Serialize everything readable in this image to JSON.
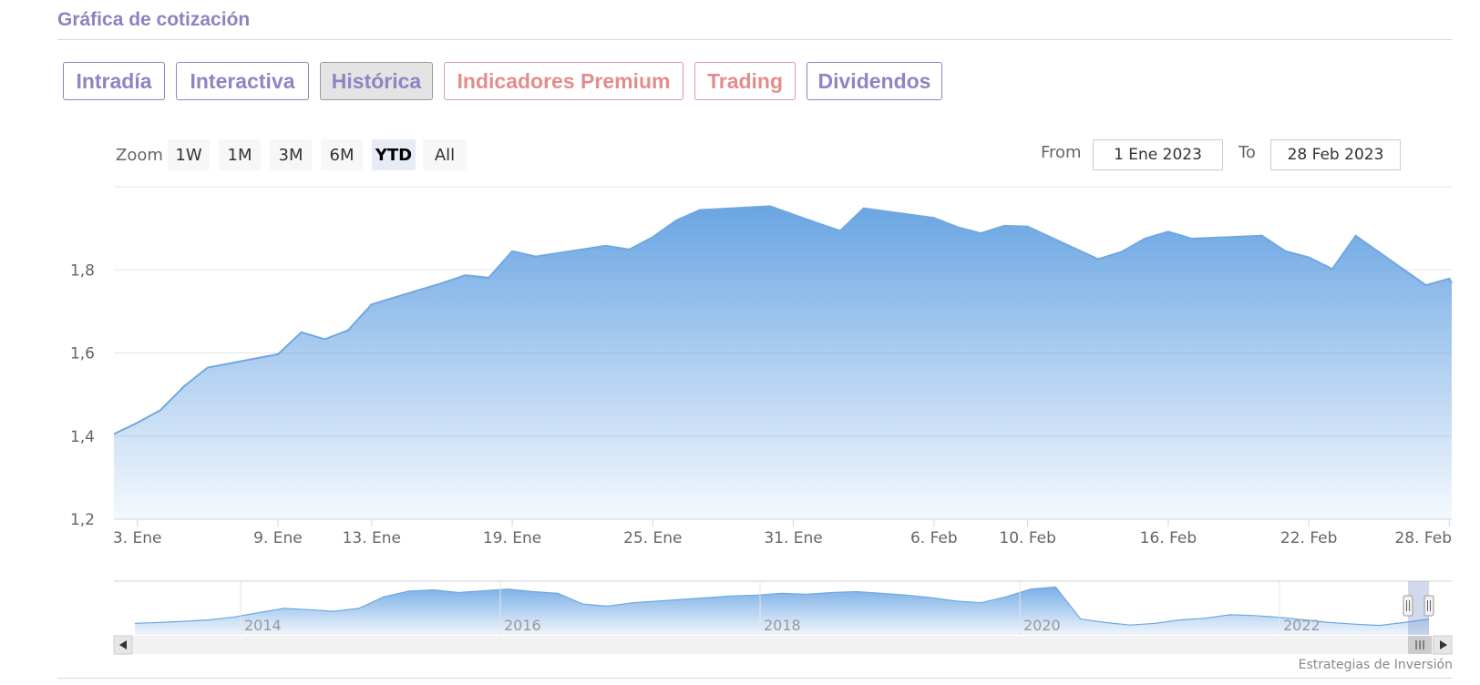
{
  "section_title": "Gráfica de cotización",
  "tabs": [
    {
      "label": "Intradía",
      "style": "normal"
    },
    {
      "label": "Interactiva",
      "style": "normal"
    },
    {
      "label": "Histórica",
      "style": "active"
    },
    {
      "label": "Indicadores Premium",
      "style": "premium"
    },
    {
      "label": "Trading",
      "style": "premium"
    },
    {
      "label": "Dividendos",
      "style": "normal"
    }
  ],
  "range_selector": {
    "zoom_label": "Zoom",
    "buttons": [
      "1W",
      "1M",
      "3M",
      "6M",
      "YTD",
      "All"
    ],
    "selected": "YTD",
    "from_label": "From",
    "from_value": "1 Ene 2023",
    "to_label": "To",
    "to_value": "28 Feb 2023"
  },
  "colors": {
    "accent": "#8a84c2",
    "premium": "#e48c8c",
    "series_line": "#6fa8e0",
    "series_fill_top": "#6aa5e3",
    "series_fill_bottom": "#f2f7fd"
  },
  "chart_data": {
    "type": "area",
    "y_tick_labels": [
      "1,2",
      "1,4",
      "1,6",
      "1,8"
    ],
    "y_ticks": [
      1.2,
      1.4,
      1.6,
      1.8
    ],
    "ylim": [
      1.2,
      2.0
    ],
    "x_tick_labels": [
      "3. Ene",
      "9. Ene",
      "13. Ene",
      "19. Ene",
      "25. Ene",
      "31. Ene",
      "6. Feb",
      "10. Feb",
      "16. Feb",
      "22. Feb",
      "28. Feb"
    ],
    "x_tick_days": [
      2,
      8,
      12,
      18,
      24,
      30,
      36,
      40,
      46,
      52,
      58
    ],
    "x_tick_values": [
      "2023-01-03",
      "2023-01-09",
      "2023-01-13",
      "2023-01-19",
      "2023-01-25",
      "2023-01-31",
      "2023-02-06",
      "2023-02-10",
      "2023-02-16",
      "2023-02-22",
      "2023-02-28"
    ],
    "xlim_days": [
      1,
      58.1
    ],
    "x_dates": [
      "2023-01-02",
      "2023-01-03",
      "2023-01-04",
      "2023-01-05",
      "2023-01-06",
      "2023-01-09",
      "2023-01-10",
      "2023-01-11",
      "2023-01-12",
      "2023-01-13",
      "2023-01-16",
      "2023-01-17",
      "2023-01-18",
      "2023-01-19",
      "2023-01-20",
      "2023-01-23",
      "2023-01-24",
      "2023-01-25",
      "2023-01-26",
      "2023-01-27",
      "2023-01-30",
      "2023-01-31",
      "2023-02-01",
      "2023-02-02",
      "2023-02-03",
      "2023-02-06",
      "2023-02-07",
      "2023-02-08",
      "2023-02-09",
      "2023-02-10",
      "2023-02-13",
      "2023-02-14",
      "2023-02-15",
      "2023-02-16",
      "2023-02-17",
      "2023-02-20",
      "2023-02-21",
      "2023-02-22",
      "2023-02-23",
      "2023-02-24",
      "2023-02-27",
      "2023-02-28"
    ],
    "x_days": [
      1,
      2,
      3,
      4,
      5,
      8,
      9,
      10,
      11,
      12,
      15,
      16,
      17,
      18,
      19,
      22,
      23,
      24,
      25,
      26,
      29,
      30,
      31,
      32,
      33,
      36,
      37,
      38,
      39,
      40,
      43,
      44,
      45,
      46,
      47,
      50,
      51,
      52,
      53,
      54,
      57,
      58
    ],
    "values": [
      1.405,
      1.432,
      1.463,
      1.52,
      1.565,
      1.597,
      1.65,
      1.633,
      1.655,
      1.717,
      1.768,
      1.787,
      1.781,
      1.845,
      1.832,
      1.858,
      1.849,
      1.879,
      1.919,
      1.944,
      1.953,
      1.933,
      1.913,
      1.894,
      1.948,
      1.925,
      1.903,
      1.888,
      1.906,
      1.904,
      1.826,
      1.843,
      1.875,
      1.892,
      1.875,
      1.882,
      1.845,
      1.83,
      1.802,
      1.882,
      1.763,
      1.779,
      1.768
    ],
    "navigator": {
      "x_labels": [
        "2014",
        "2016",
        "2018",
        "2020",
        "2022"
      ],
      "series": [
        0.1,
        0.12,
        0.15,
        0.18,
        0.25,
        0.35,
        0.45,
        0.42,
        0.38,
        0.45,
        0.72,
        0.85,
        0.88,
        0.82,
        0.86,
        0.9,
        0.84,
        0.8,
        0.55,
        0.5,
        0.58,
        0.62,
        0.66,
        0.7,
        0.74,
        0.76,
        0.8,
        0.78,
        0.82,
        0.84,
        0.8,
        0.76,
        0.7,
        0.62,
        0.58,
        0.72,
        0.9,
        0.95,
        0.2,
        0.12,
        0.06,
        0.1,
        0.18,
        0.22,
        0.3,
        0.28,
        0.24,
        0.18,
        0.12,
        0.08,
        0.05,
        0.12,
        0.2
      ]
    }
  },
  "credit": "Estrategias de Inversión"
}
